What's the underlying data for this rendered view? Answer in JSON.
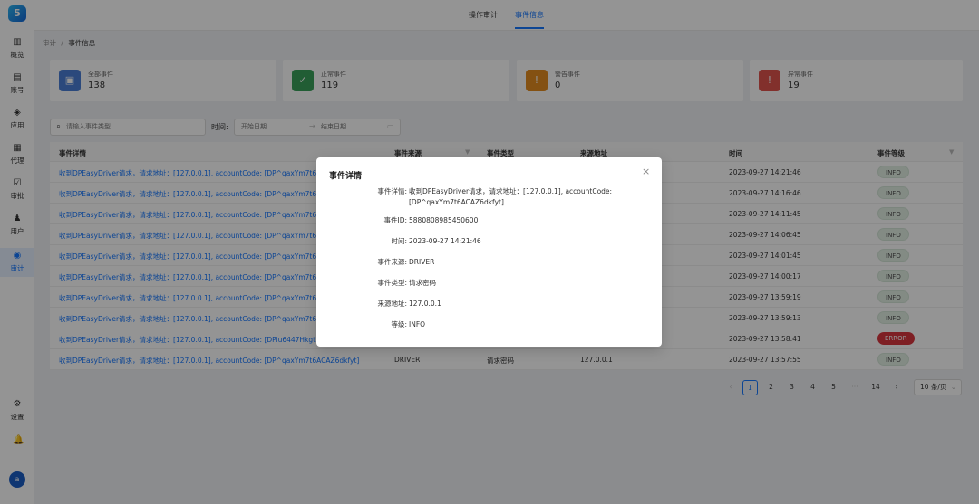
{
  "sidebar": {
    "logo": "5",
    "items": [
      {
        "label": "概览",
        "icon": "chart-icon",
        "glyph": "▥"
      },
      {
        "label": "账号",
        "icon": "account-icon",
        "glyph": "▤"
      },
      {
        "label": "应用",
        "icon": "cube-icon",
        "glyph": "◈"
      },
      {
        "label": "代理",
        "icon": "grid-icon",
        "glyph": "▦"
      },
      {
        "label": "审批",
        "icon": "check-icon",
        "glyph": "☑"
      },
      {
        "label": "用户",
        "icon": "user-icon",
        "glyph": "♟"
      },
      {
        "label": "审计",
        "icon": "audit-icon",
        "glyph": "◉"
      }
    ],
    "settings_label": "设置",
    "settings_glyph": "⚙",
    "bell_glyph": "🔔",
    "avatar": "a"
  },
  "topbar": {
    "tabs": [
      {
        "label": "操作审计"
      },
      {
        "label": "事件信息"
      }
    ],
    "active_color": "#1677ff"
  },
  "breadcrumb": {
    "parent": "审计",
    "separator": "/",
    "current": "事件信息"
  },
  "cards": [
    {
      "title": "全部事件",
      "value": "138",
      "icon": "all-events-icon",
      "glyph": "▣",
      "color": "#4a7fd6",
      "bg": "#dfe9fb"
    },
    {
      "title": "正常事件",
      "value": "119",
      "icon": "normal-events-icon",
      "glyph": "✓",
      "color": "#3aa15a",
      "bg": "#d9f0df"
    },
    {
      "title": "警告事件",
      "value": "0",
      "icon": "warning-events-icon",
      "glyph": "!",
      "color": "#e38c1f",
      "bg": "#fbe9d3"
    },
    {
      "title": "异常事件",
      "value": "19",
      "icon": "error-events-icon",
      "glyph": "!",
      "color": "#e0534c",
      "bg": "#fbdfdd"
    }
  ],
  "filters": {
    "search_placeholder": "请输入事件类型",
    "time_label": "时间:",
    "start_placeholder": "开始日期",
    "end_placeholder": "结束日期",
    "arrow": "→"
  },
  "table": {
    "headers": [
      "事件详情",
      "事件来源",
      "事件类型",
      "来源地址",
      "时间",
      "事件等级"
    ],
    "rows": [
      {
        "detail": "收到DPEasyDriver请求，请求地址：[127.0.0.1], accountCode: [DP^qaxYm7t6ACAZ6dkfyt]",
        "source": "",
        "type": "",
        "addr": "",
        "time": "2023-09-27 14:21:46",
        "level": "INFO"
      },
      {
        "detail": "收到DPEasyDriver请求，请求地址：[127.0.0.1], accountCode: [DP^qaxYm7t6ACAZ6dkfyt]",
        "source": "",
        "type": "",
        "addr": "",
        "time": "2023-09-27 14:16:46",
        "level": "INFO"
      },
      {
        "detail": "收到DPEasyDriver请求，请求地址：[127.0.0.1], accountCode: [DP^qaxYm7t6ACAZ6dkfyt]",
        "source": "",
        "type": "",
        "addr": "",
        "time": "2023-09-27 14:11:45",
        "level": "INFO"
      },
      {
        "detail": "收到DPEasyDriver请求，请求地址：[127.0.0.1], accountCode: [DP^qaxYm7t6ACAZ6dkfyt]",
        "source": "",
        "type": "",
        "addr": "",
        "time": "2023-09-27 14:06:45",
        "level": "INFO"
      },
      {
        "detail": "收到DPEasyDriver请求，请求地址：[127.0.0.1], accountCode: [DP^qaxYm7t6ACAZ6dkfyt]",
        "source": "",
        "type": "",
        "addr": "",
        "time": "2023-09-27 14:01:45",
        "level": "INFO"
      },
      {
        "detail": "收到DPEasyDriver请求，请求地址：[127.0.0.1], accountCode: [DP^qaxYm7t6ACAZ6dkfyt]",
        "source": "",
        "type": "",
        "addr": "",
        "time": "2023-09-27 14:00:17",
        "level": "INFO"
      },
      {
        "detail": "收到DPEasyDriver请求，请求地址：[127.0.0.1], accountCode: [DP^qaxYm7t6ACAZ6dkfyt]",
        "source": "",
        "type": "",
        "addr": "",
        "time": "2023-09-27 13:59:19",
        "level": "INFO"
      },
      {
        "detail": "收到DPEasyDriver请求，请求地址：[127.0.0.1], accountCode: [DP^qaxYm7t6ACAZ6dkfyt]",
        "source": "",
        "type": "",
        "addr": "",
        "time": "2023-09-27 13:59:13",
        "level": "INFO"
      },
      {
        "detail": "收到DPEasyDriver请求，请求地址：[127.0.0.1], accountCode: [DPiu6447Hkgt5w",
        "source": "",
        "type": "",
        "addr": "",
        "time": "2023-09-27 13:58:41",
        "level": "ERROR"
      },
      {
        "detail": "收到DPEasyDriver请求，请求地址：[127.0.0.1], accountCode: [DP^qaxYm7t6ACAZ6dkfyt]",
        "source": "DRIVER",
        "type": "请求密码",
        "addr": "127.0.0.1",
        "time": "2023-09-27 13:57:55",
        "level": "INFO"
      }
    ]
  },
  "pagination": {
    "prev": "‹",
    "pages": [
      "1",
      "2",
      "3",
      "4",
      "5",
      "···",
      "14"
    ],
    "next": "›",
    "page_size": "10 条/页",
    "current": "1"
  },
  "modal": {
    "title": "事件详情",
    "close": "×",
    "fields": [
      {
        "label": "事件详情:",
        "value": "收到DPEasyDriver请求，请求地址：[127.0.0.1], accountCode: [DP^qaxYm7t6ACAZ6dkfyt]"
      },
      {
        "label": "事件ID:",
        "value": "5880808985450600"
      },
      {
        "label": "时间:",
        "value": "2023-09-27 14:21:46"
      },
      {
        "label": "事件来源:",
        "value": "DRIVER"
      },
      {
        "label": "事件类型:",
        "value": "请求密码"
      },
      {
        "label": "来源地址:",
        "value": "127.0.0.1"
      },
      {
        "label": "等级:",
        "value": "INFO"
      }
    ]
  }
}
